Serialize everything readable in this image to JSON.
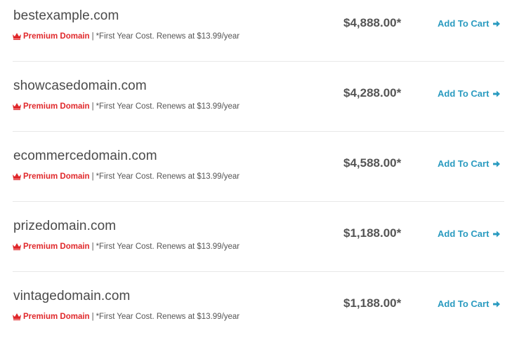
{
  "colors": {
    "premium": "#e0282b",
    "cart_link": "#2a9bc0",
    "divider": "#e8e8e8"
  },
  "icons": {
    "premium": "crown-icon",
    "cart": "arrow-right-icon"
  },
  "results": [
    {
      "domain": "bestexample.com",
      "premium_label": "Premium Domain",
      "separator": "|",
      "note": "*First Year Cost. Renews at $13.99/year",
      "price": "$4,888.00*",
      "cart_label": "Add To Cart"
    },
    {
      "domain": "showcasedomain.com",
      "premium_label": "Premium Domain",
      "separator": "|",
      "note": "*First Year Cost. Renews at $13.99/year",
      "price": "$4,288.00*",
      "cart_label": "Add To Cart"
    },
    {
      "domain": "ecommercedomain.com",
      "premium_label": "Premium Domain",
      "separator": "|",
      "note": "*First Year Cost. Renews at $13.99/year",
      "price": "$4,588.00*",
      "cart_label": "Add To Cart"
    },
    {
      "domain": "prizedomain.com",
      "premium_label": "Premium Domain",
      "separator": "|",
      "note": "*First Year Cost. Renews at $13.99/year",
      "price": "$1,188.00*",
      "cart_label": "Add To Cart"
    },
    {
      "domain": "vintagedomain.com",
      "premium_label": "Premium Domain",
      "separator": "|",
      "note": "*First Year Cost. Renews at $13.99/year",
      "price": "$1,188.00*",
      "cart_label": "Add To Cart"
    }
  ]
}
